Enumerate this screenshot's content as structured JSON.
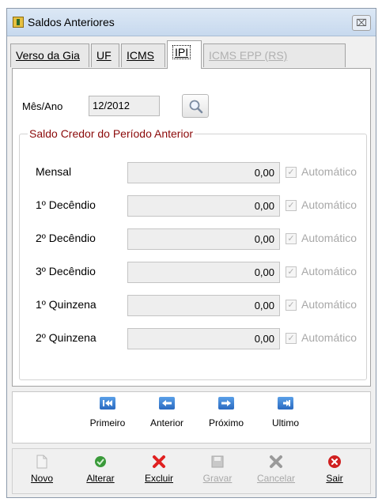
{
  "window": {
    "title": "Saldos Anteriores",
    "close_label": "⌧"
  },
  "tabs": [
    {
      "label": "Verso da Gia",
      "state": "normal"
    },
    {
      "label": "UF",
      "state": "normal"
    },
    {
      "label": "ICMS",
      "state": "normal"
    },
    {
      "label": "IPI",
      "state": "active"
    },
    {
      "label": "ICMS EPP (RS)",
      "state": "disabled"
    }
  ],
  "period": {
    "label": "Mês/Ano",
    "value": "12/2012"
  },
  "group": {
    "title": "Saldo Credor do Período Anterior",
    "checkbox_label": "Automático",
    "rows": [
      {
        "label": "Mensal",
        "value": "0,00",
        "checked": true
      },
      {
        "label": "1º Decêndio",
        "value": "0,00",
        "checked": true
      },
      {
        "label": "2º Decêndio",
        "value": "0,00",
        "checked": true
      },
      {
        "label": "3º Decêndio",
        "value": "0,00",
        "checked": true
      },
      {
        "label": "1º Quinzena",
        "value": "0,00",
        "checked": true
      },
      {
        "label": "2º Quinzena",
        "value": "0,00",
        "checked": true
      }
    ]
  },
  "navigation": [
    {
      "label": "Primeiro",
      "icon": "first-record-icon"
    },
    {
      "label": "Anterior",
      "icon": "previous-record-icon"
    },
    {
      "label": "Próximo",
      "icon": "next-record-icon"
    },
    {
      "label": "Ultimo",
      "icon": "last-record-icon"
    }
  ],
  "actions": [
    {
      "label": "Novo",
      "icon": "new-icon",
      "enabled": true
    },
    {
      "label": "Alterar",
      "icon": "edit-icon",
      "enabled": true
    },
    {
      "label": "Excluir",
      "icon": "delete-icon",
      "enabled": true
    },
    {
      "label": "Gravar",
      "icon": "save-icon",
      "enabled": false
    },
    {
      "label": "Cancelar",
      "icon": "cancel-icon",
      "enabled": false
    },
    {
      "label": "Sair",
      "icon": "exit-icon",
      "enabled": true
    }
  ],
  "colors": {
    "group_title": "#8b0a0a",
    "disabled_text": "#a8a8a8",
    "nav_icon": "#2a6ac0",
    "delete_red": "#e02020",
    "edit_green": "#3a9a3a"
  }
}
